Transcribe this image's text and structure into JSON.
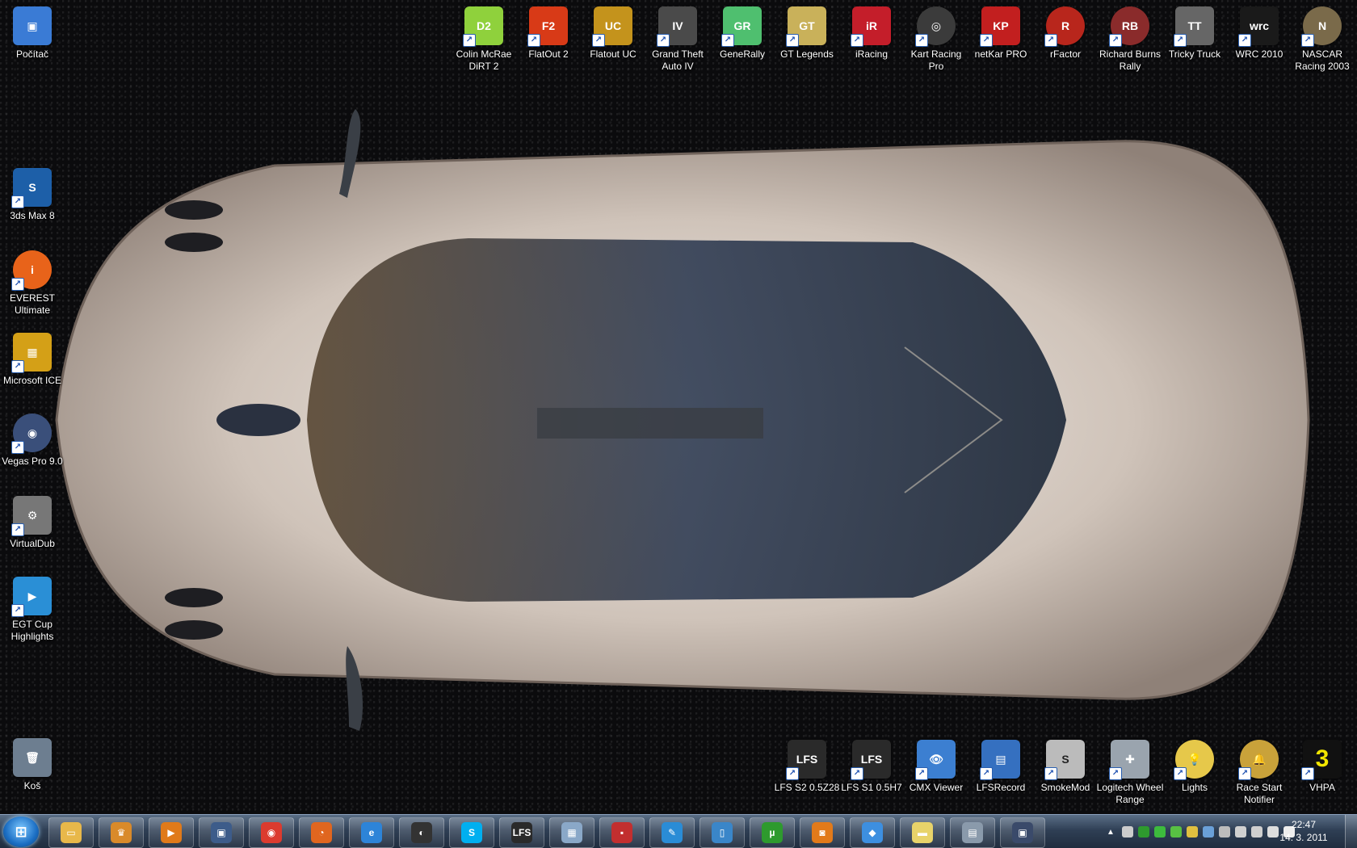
{
  "desktop": {
    "left_icons": [
      {
        "label": "Počítač",
        "icon": "computer-icon",
        "color": "#3a7bd5",
        "glyph": "▣"
      },
      {
        "label": "3ds Max 8",
        "icon": "3dsmax-icon",
        "color": "#1d5fa8",
        "glyph": "S"
      },
      {
        "label": "EVEREST Ultimate",
        "icon": "everest-icon",
        "color": "#e8631a",
        "glyph": "i"
      },
      {
        "label": "Microsoft ICE",
        "icon": "microsoft-ice-icon",
        "color": "#d4a017",
        "glyph": "▦"
      },
      {
        "label": "Vegas Pro 9.0",
        "icon": "vegas-icon",
        "color": "#3a4f7a",
        "glyph": "◉"
      },
      {
        "label": "VirtualDub",
        "icon": "virtualdub-icon",
        "color": "#777777",
        "glyph": "⚙"
      },
      {
        "label": "EGT Cup Highlights",
        "icon": "video-file-icon",
        "color": "#2a8fd6",
        "glyph": "▶"
      },
      {
        "label": "Koš",
        "icon": "recycle-bin-icon",
        "color": "#6d7e90",
        "glyph": "🗑"
      }
    ],
    "top_icons": [
      {
        "label": "Colin McRae DiRT 2",
        "icon": "dirt2-icon",
        "color": "#8fd13c",
        "glyph": "D2"
      },
      {
        "label": "FlatOut 2",
        "icon": "flatout2-icon",
        "color": "#d83a17",
        "glyph": "F2"
      },
      {
        "label": "Flatout UC",
        "icon": "flatout-uc-icon",
        "color": "#c4931c",
        "glyph": "UC"
      },
      {
        "label": "Grand Theft Auto IV",
        "icon": "gta4-icon",
        "color": "#4a4a4a",
        "glyph": "IV"
      },
      {
        "label": "GeneRally",
        "icon": "generally-icon",
        "color": "#4fbf6f",
        "glyph": "GR"
      },
      {
        "label": "GT Legends",
        "icon": "gt-legends-icon",
        "color": "#c9b15a",
        "glyph": "GT"
      },
      {
        "label": "iRacing",
        "icon": "iracing-icon",
        "color": "#c41e2a",
        "glyph": "iR"
      },
      {
        "label": "Kart Racing Pro",
        "icon": "kart-racing-icon",
        "color": "#3b3b3b",
        "glyph": "◎"
      },
      {
        "label": "netKar PRO",
        "icon": "netkar-icon",
        "color": "#c21f1f",
        "glyph": "KP"
      },
      {
        "label": "rFactor",
        "icon": "rfactor-icon",
        "color": "#b8261c",
        "glyph": "R"
      },
      {
        "label": "Richard Burns Rally",
        "icon": "rbr-icon",
        "color": "#8a2b2b",
        "glyph": "RB"
      },
      {
        "label": "Tricky Truck",
        "icon": "tricky-truck-icon",
        "color": "#666666",
        "glyph": "TT"
      },
      {
        "label": "WRC 2010",
        "icon": "wrc-icon",
        "color": "#1a1a1a",
        "glyph": "wrc"
      },
      {
        "label": "NASCAR Racing 2003",
        "icon": "nascar-icon",
        "color": "#7a6a4a",
        "glyph": "N"
      }
    ],
    "bottom_icons": [
      {
        "label": "LFS S2 0.5Z28",
        "icon": "lfs-icon",
        "color": "#2a2a2a",
        "glyph": "LFS"
      },
      {
        "label": "LFS S1 0.5H7",
        "icon": "lfs-icon",
        "color": "#2a2a2a",
        "glyph": "LFS"
      },
      {
        "label": "CMX Viewer",
        "icon": "cmx-viewer-icon",
        "color": "#3c7fd1",
        "glyph": "👁"
      },
      {
        "label": "LFSRecord",
        "icon": "lfsrecord-icon",
        "color": "#3570c0",
        "glyph": "▤"
      },
      {
        "label": "SmokeMod",
        "icon": "smokemod-icon",
        "color": "#bbbbbb",
        "glyph": "S"
      },
      {
        "label": "Logitech Wheel Range",
        "icon": "gamepad-icon",
        "color": "#9aa4ae",
        "glyph": "✚"
      },
      {
        "label": "Lights",
        "icon": "lightbulb-icon",
        "color": "#e6c84a",
        "glyph": "💡"
      },
      {
        "label": "Race Start Notifier",
        "icon": "bell-icon",
        "color": "#c9a23a",
        "glyph": "🔔"
      },
      {
        "label": "VHPA",
        "icon": "vhpa-icon",
        "color": "#111111",
        "glyph": "3"
      }
    ]
  },
  "taskbar": {
    "start_glyph": "⊞",
    "pinned": [
      {
        "icon": "explorer-folder-icon",
        "color": "#e8b84a",
        "glyph": "▭"
      },
      {
        "icon": "pinned-app-icon",
        "color": "#d98a2a",
        "glyph": "♛"
      },
      {
        "icon": "media-player-icon",
        "color": "#e07a1a",
        "glyph": "▶"
      },
      {
        "icon": "monitor-app-icon",
        "color": "#3d5c8a",
        "glyph": "▣"
      },
      {
        "icon": "chrome-icon",
        "color": "#dc3b2f",
        "glyph": "◉"
      },
      {
        "icon": "firefox-icon",
        "color": "#e0661f",
        "glyph": "◔"
      },
      {
        "icon": "internet-explorer-icon",
        "color": "#2d84d8",
        "glyph": "e"
      },
      {
        "icon": "steam-icon",
        "color": "#333333",
        "glyph": "◐"
      },
      {
        "icon": "skype-icon",
        "color": "#00aff0",
        "glyph": "S"
      },
      {
        "icon": "lfs-icon",
        "color": "#2a2a2a",
        "glyph": "LFS"
      },
      {
        "icon": "calculator-icon",
        "color": "#8aa8c8",
        "glyph": "▦"
      },
      {
        "icon": "save-disk-icon",
        "color": "#c22f2f",
        "glyph": "▪"
      },
      {
        "icon": "quill-icon",
        "color": "#2a8cd6",
        "glyph": "✎"
      },
      {
        "icon": "book-icon",
        "color": "#3a86c9",
        "glyph": "▯"
      },
      {
        "icon": "utorrent-icon",
        "color": "#2e9a2e",
        "glyph": "µ"
      },
      {
        "icon": "photo-icon",
        "color": "#e27a1a",
        "glyph": "◙"
      },
      {
        "icon": "dropbox-icon",
        "color": "#3d8fe0",
        "glyph": "◆"
      },
      {
        "icon": "sticky-notes-icon",
        "color": "#e8d36a",
        "glyph": "▬"
      },
      {
        "icon": "notepad-icon",
        "color": "#8a9aab",
        "glyph": "▤"
      },
      {
        "icon": "remote-desktop-icon",
        "color": "#3a4a6a",
        "glyph": "▣"
      }
    ],
    "tray_colors": [
      "#cccccc",
      "#2e9a2e",
      "#3dbb3d",
      "#58c043",
      "#e0c040",
      "#6aa0d8",
      "#bcbcbc",
      "#d0d0d0",
      "#cfcfcf",
      "#dddddd",
      "#eeeeee"
    ],
    "clock": {
      "time": "22:47",
      "date": "14. 3. 2011"
    }
  }
}
